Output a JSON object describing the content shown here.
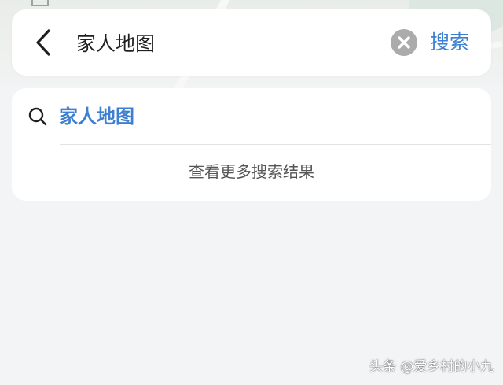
{
  "search_bar": {
    "back_icon": "chevron-left-icon",
    "query": "家人地图",
    "clear_icon": "close-circle-icon",
    "submit_label": "搜索"
  },
  "suggestions": {
    "items": [
      {
        "icon": "search-icon",
        "text": "家人地图"
      }
    ],
    "more_label": "查看更多搜索结果"
  },
  "watermark": {
    "text": "头条 @爱乡村的小九"
  },
  "colors": {
    "accent": "#3d7fd1",
    "background": "#f3f4f6",
    "card": "#ffffff",
    "clear_button": "#ababab"
  }
}
